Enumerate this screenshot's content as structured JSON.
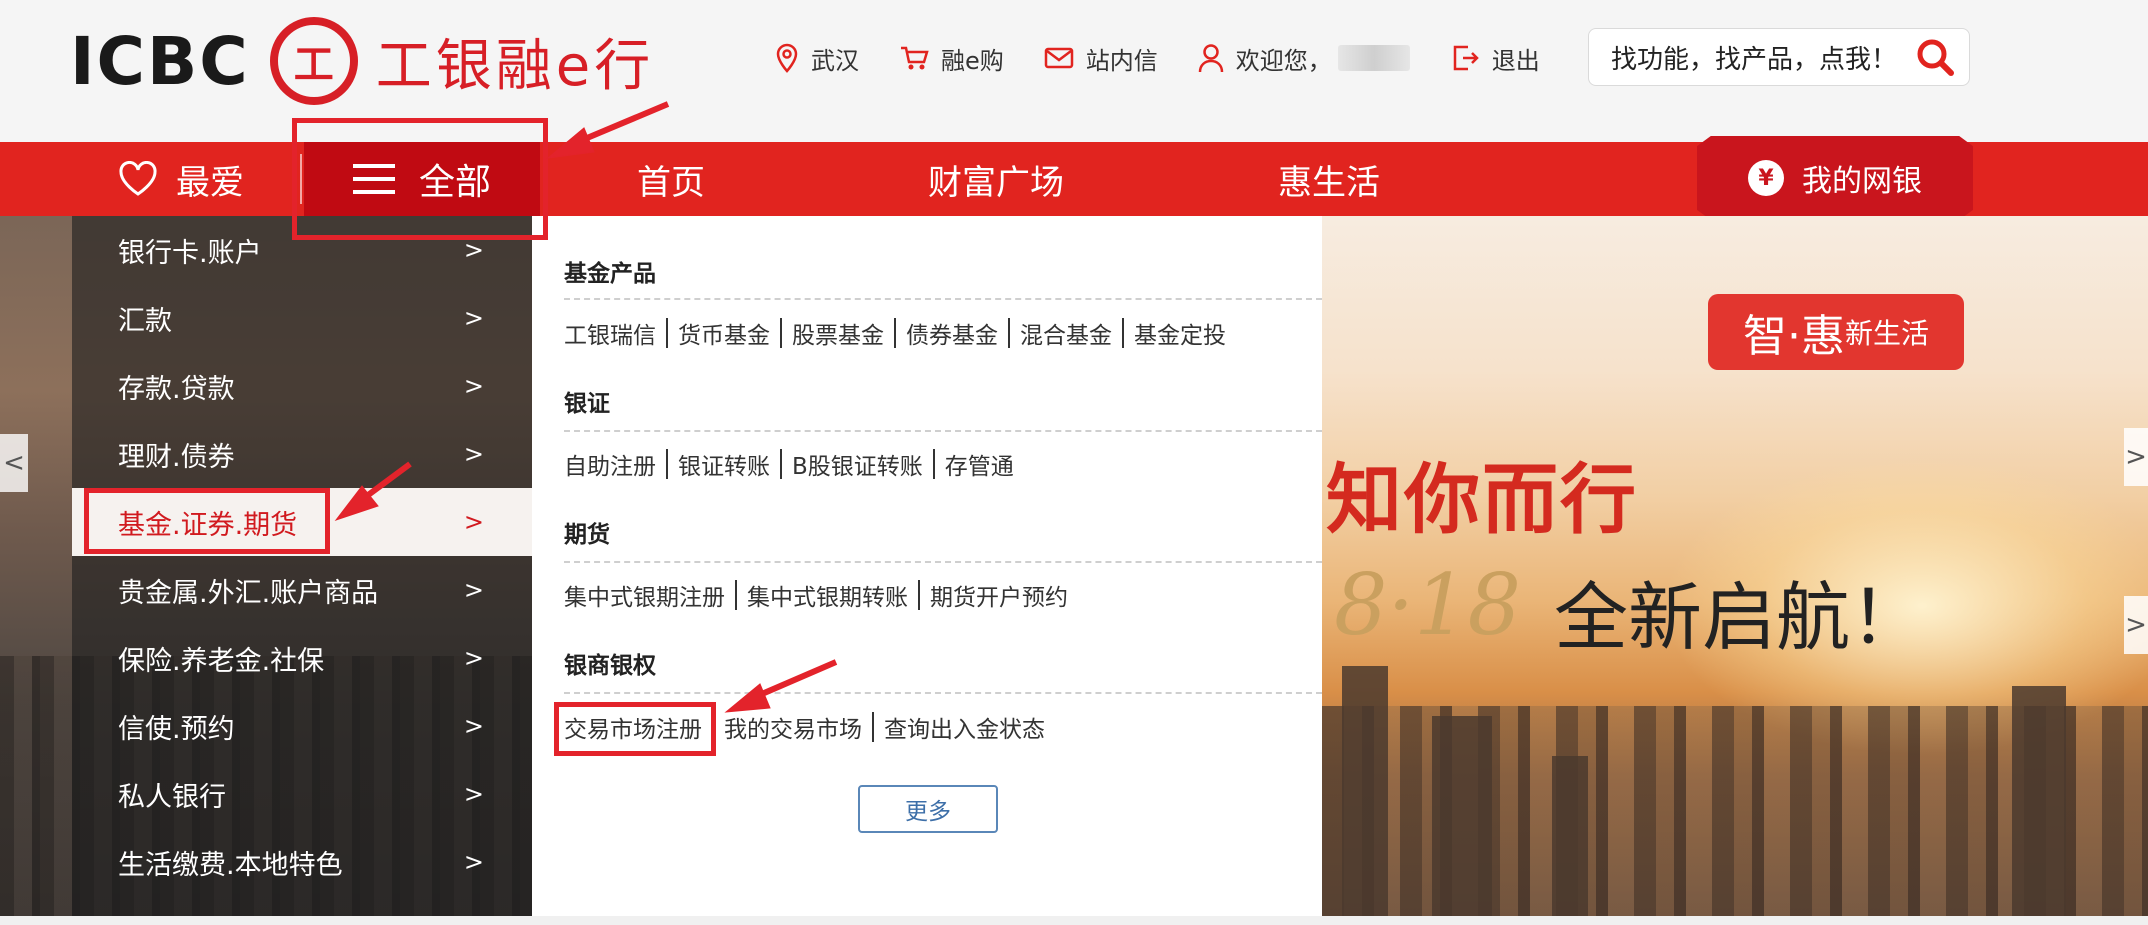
{
  "brand": {
    "logo_text": "ICBC",
    "emblem_glyph": "工",
    "name": "工银融e行",
    "accent_color": "#e1241f"
  },
  "topnav": {
    "location": "武汉",
    "shop": "融e购",
    "messages": "站内信",
    "welcome": "欢迎您，",
    "logout": "退出"
  },
  "search": {
    "placeholder": "找功能，找产品，点我！"
  },
  "navbar": {
    "favorites": "最爱",
    "all": "全部",
    "home": "首页",
    "wealth": "财富广场",
    "life": "惠生活",
    "mybank": "我的网银",
    "mybank_icon_glyph": "¥"
  },
  "sidebar": {
    "items": [
      {
        "label": "银行卡.账户",
        "chev": ">"
      },
      {
        "label": "汇款",
        "chev": ">"
      },
      {
        "label": "存款.贷款",
        "chev": ">"
      },
      {
        "label": "理财.债券",
        "chev": ">"
      },
      {
        "label": "基金.证券.期货",
        "chev": ">"
      },
      {
        "label": "贵金属.外汇.账户商品",
        "chev": ">"
      },
      {
        "label": "保险.养老金.社保",
        "chev": ">"
      },
      {
        "label": "信使.预约",
        "chev": ">"
      },
      {
        "label": "私人银行",
        "chev": ">"
      },
      {
        "label": "生活缴费.本地特色",
        "chev": ">"
      }
    ],
    "active_index": 4
  },
  "panel": {
    "groups": [
      {
        "title": "基金产品",
        "links": [
          "工银瑞信",
          "货币基金",
          "股票基金",
          "债券基金",
          "混合基金",
          "基金定投"
        ]
      },
      {
        "title": "银证",
        "links": [
          "自助注册",
          "银证转账",
          "B股银证转账",
          "存管通"
        ]
      },
      {
        "title": "期货",
        "links": [
          "集中式银期注册",
          "集中式银期转账",
          "期货开户预约"
        ]
      },
      {
        "title": "银商银权",
        "links": [
          "交易市场注册",
          "我的交易市场",
          "查询出入金状态"
        ]
      }
    ],
    "more": "更多"
  },
  "banner": {
    "badge_main": "智·惠",
    "badge_sub": "新生活",
    "slogan_line1": "知你而行",
    "slogan_number": "8·18",
    "slogan_line2": "全新启航！"
  },
  "carousel": {
    "prev": "<",
    "next": ">"
  },
  "annotation_color": "#e3232b"
}
